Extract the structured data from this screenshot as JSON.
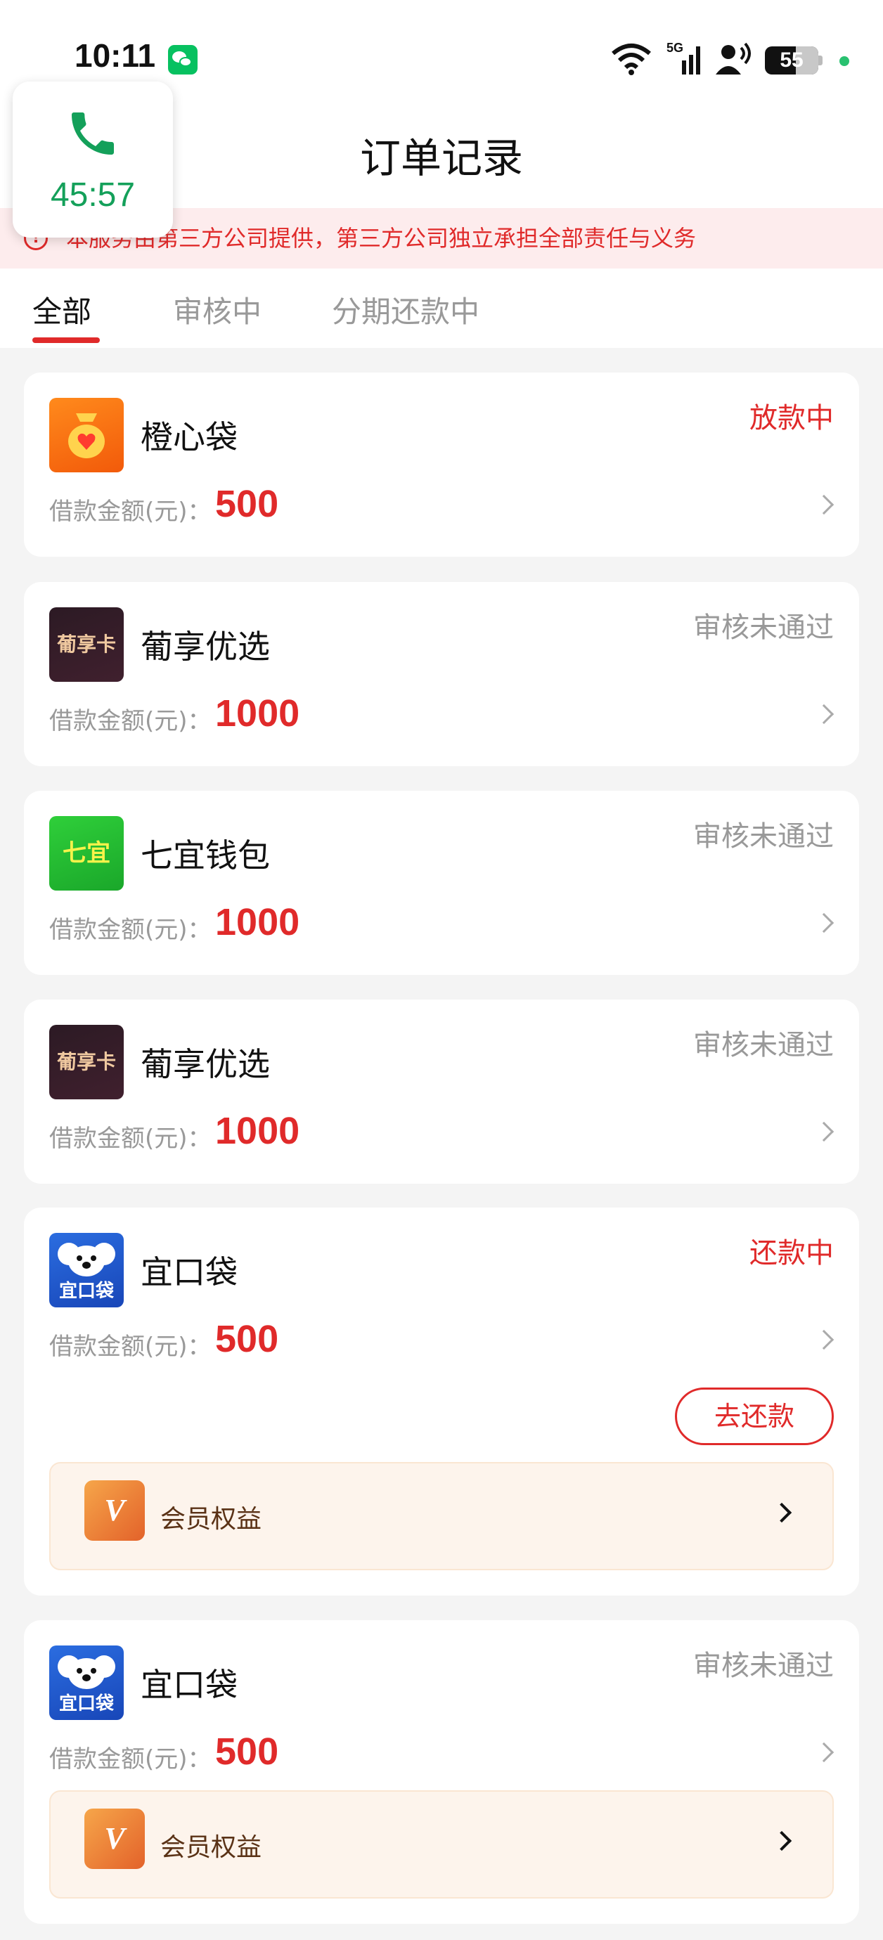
{
  "status_bar": {
    "time": "10:11",
    "network": "5G",
    "battery": "55"
  },
  "call": {
    "timer": "45:57"
  },
  "header": {
    "title": "订单记录"
  },
  "notice": {
    "text": "本服务由第三方公司提供，第三方公司独立承担全部责任与义务"
  },
  "tabs": [
    {
      "label": "全部",
      "active": true
    },
    {
      "label": "审核中",
      "active": false
    },
    {
      "label": "分期还款中",
      "active": false
    }
  ],
  "amount_label": "借款金额(元)：",
  "orders": [
    {
      "name": "橙心袋",
      "status": "放款中",
      "amount": "500",
      "logo": "orange-bag-icon"
    },
    {
      "name": "葡享优选",
      "status": "审核未通过",
      "amount": "1000",
      "logo": "purple-card-icon",
      "logo_text": "葡享卡"
    },
    {
      "name": "七宜钱包",
      "status": "审核未通过",
      "amount": "1000",
      "logo": "green-icon",
      "logo_text": "七宜"
    },
    {
      "name": "葡享优选",
      "status": "审核未通过",
      "amount": "1000",
      "logo": "purple-card-icon",
      "logo_text": "葡享卡"
    },
    {
      "name": "宜口袋",
      "status": "还款中",
      "amount": "500",
      "logo": "koala-icon",
      "logo_text": "宜口袋",
      "action": "去还款",
      "vip": "会员权益"
    },
    {
      "name": "宜口袋",
      "status": "审核未通过",
      "amount": "500",
      "logo": "koala-icon",
      "logo_text": "宜口袋",
      "vip": "会员权益"
    }
  ],
  "colors": {
    "accent_red": "#e02a2a",
    "muted_gray": "#999999",
    "call_green": "#14a05a"
  }
}
